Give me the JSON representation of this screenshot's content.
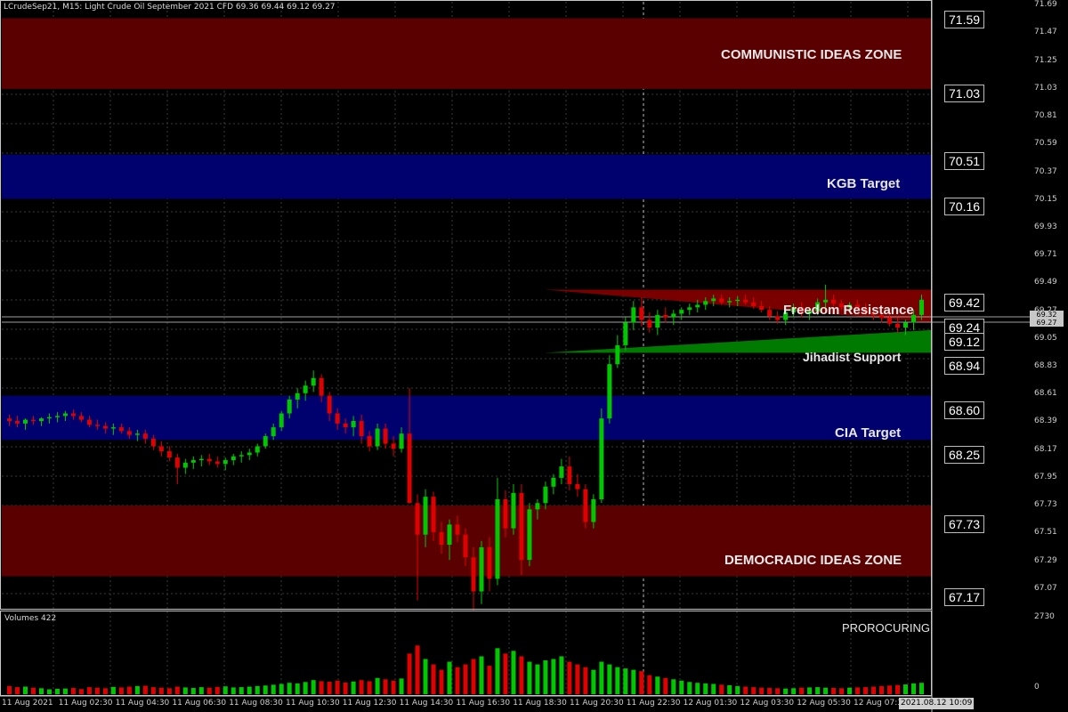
{
  "header": {
    "symbol_info": "LCrudeSep21, M15:  Light Crude Oil September 2021 CFD  69.36 69.44 69.12 69.27"
  },
  "zones": [
    {
      "name": "communistic",
      "label": "COMMUNISTIC IDEAS ZONE",
      "top": 71.59,
      "bottom": 71.03,
      "color": "#5a0000"
    },
    {
      "name": "kgb",
      "label": "KGB Target",
      "top": 70.51,
      "bottom": 70.16,
      "color": "#00006e"
    },
    {
      "name": "cia",
      "label": "CIA Target",
      "top": 68.6,
      "bottom": 68.25,
      "color": "#00006e"
    },
    {
      "name": "democradic",
      "label": "DEMOCRADIC IDEAS ZONE",
      "top": 67.73,
      "bottom": 67.17,
      "color": "#5a0000"
    }
  ],
  "wedges": {
    "resistance_label": "Freedom Resistance",
    "support_label": "Jihadist Support"
  },
  "level_tags": [
    "71.59",
    "71.03",
    "70.51",
    "70.16",
    "69.42",
    "69.24",
    "69.12",
    "68.94",
    "68.60",
    "68.25",
    "67.73",
    "67.17"
  ],
  "price_scale": [
    "71.69",
    "71.47",
    "71.25",
    "71.03",
    "70.81",
    "70.59",
    "70.37",
    "70.15",
    "69.93",
    "69.71",
    "69.49",
    "69.27",
    "69.05",
    "68.83",
    "68.61",
    "68.39",
    "68.17",
    "67.95",
    "67.73",
    "67.51",
    "67.29",
    "67.07"
  ],
  "current_price": {
    "top": "69.32",
    "bottom": "69.27"
  },
  "time_scale": [
    "11 Aug 2021",
    "11 Aug 02:30",
    "11 Aug 04:30",
    "11 Aug 06:30",
    "11 Aug 08:30",
    "11 Aug 10:30",
    "11 Aug 12:30",
    "11 Aug 14:30",
    "11 Aug 16:30",
    "11 Aug 18:30",
    "11 Aug 20:30",
    "11 Aug 22:30",
    "12 Aug 01:30",
    "12 Aug 03:30",
    "12 Aug 05:30",
    "12 Aug 07:30"
  ],
  "cursor_time": "2021.08.12 10:09",
  "volume": {
    "label": "Volumes 422",
    "max_label": "2730",
    "min_label": "0",
    "indicator": "PROROCURING"
  },
  "colors": {
    "bull": "#00c800",
    "bear": "#e00000",
    "grid": "#3a3a3a",
    "resist": "#7a0000",
    "support": "#007a00"
  },
  "chart_data": {
    "type": "candlestick",
    "ylim": [
      66.92,
      71.72
    ],
    "candles": [
      [
        68.42,
        68.45,
        68.36,
        68.4
      ],
      [
        68.4,
        68.44,
        68.35,
        68.38
      ],
      [
        68.38,
        68.42,
        68.33,
        68.41
      ],
      [
        68.41,
        68.44,
        68.37,
        68.4
      ],
      [
        68.4,
        68.43,
        68.36,
        68.42
      ],
      [
        68.42,
        68.46,
        68.38,
        68.43
      ],
      [
        68.43,
        68.47,
        68.39,
        68.44
      ],
      [
        68.44,
        68.48,
        68.4,
        68.46
      ],
      [
        68.46,
        68.49,
        68.41,
        68.44
      ],
      [
        68.44,
        68.47,
        68.39,
        68.41
      ],
      [
        68.41,
        68.44,
        68.35,
        68.37
      ],
      [
        68.37,
        68.41,
        68.33,
        68.36
      ],
      [
        68.36,
        68.39,
        68.3,
        68.34
      ],
      [
        68.34,
        68.38,
        68.29,
        68.35
      ],
      [
        68.35,
        68.38,
        68.3,
        68.32
      ],
      [
        68.32,
        68.35,
        68.26,
        68.29
      ],
      [
        68.29,
        68.33,
        68.24,
        68.3
      ],
      [
        68.3,
        68.33,
        68.22,
        68.26
      ],
      [
        68.26,
        68.29,
        68.17,
        68.2
      ],
      [
        68.2,
        68.24,
        68.12,
        68.16
      ],
      [
        68.16,
        68.2,
        68.08,
        68.11
      ],
      [
        68.11,
        68.14,
        67.9,
        68.03
      ],
      [
        68.03,
        68.1,
        67.98,
        68.07
      ],
      [
        68.07,
        68.12,
        68.02,
        68.09
      ],
      [
        68.09,
        68.13,
        68.04,
        68.1
      ],
      [
        68.1,
        68.14,
        68.05,
        68.08
      ],
      [
        68.08,
        68.12,
        68.03,
        68.06
      ],
      [
        68.06,
        68.11,
        68.01,
        68.09
      ],
      [
        68.09,
        68.14,
        68.05,
        68.12
      ],
      [
        68.12,
        68.16,
        68.07,
        68.13
      ],
      [
        68.13,
        68.18,
        68.09,
        68.15
      ],
      [
        68.15,
        68.22,
        68.12,
        68.2
      ],
      [
        68.2,
        68.3,
        68.18,
        68.28
      ],
      [
        68.28,
        68.38,
        68.25,
        68.35
      ],
      [
        68.35,
        68.48,
        68.32,
        68.46
      ],
      [
        68.46,
        68.6,
        68.42,
        68.57
      ],
      [
        68.57,
        68.66,
        68.5,
        68.62
      ],
      [
        68.62,
        68.72,
        68.56,
        68.68
      ],
      [
        68.68,
        68.8,
        68.63,
        68.74
      ],
      [
        68.74,
        68.77,
        68.55,
        68.6
      ],
      [
        68.6,
        68.63,
        68.4,
        68.46
      ],
      [
        68.46,
        68.5,
        68.33,
        68.38
      ],
      [
        68.38,
        68.42,
        68.3,
        68.35
      ],
      [
        68.35,
        68.44,
        68.28,
        68.4
      ],
      [
        68.4,
        68.45,
        68.22,
        68.28
      ],
      [
        68.28,
        68.32,
        68.16,
        68.2
      ],
      [
        68.2,
        68.38,
        68.17,
        68.34
      ],
      [
        68.34,
        68.38,
        68.18,
        68.22
      ],
      [
        68.22,
        68.28,
        68.12,
        68.18
      ],
      [
        68.18,
        68.35,
        68.15,
        68.3
      ],
      [
        68.3,
        68.66,
        68.2,
        67.75
      ],
      [
        67.75,
        67.82,
        66.98,
        67.5
      ],
      [
        67.5,
        67.86,
        67.4,
        67.8
      ],
      [
        67.8,
        67.84,
        67.45,
        67.52
      ],
      [
        67.52,
        67.6,
        67.35,
        67.42
      ],
      [
        67.42,
        67.62,
        67.3,
        67.58
      ],
      [
        67.58,
        67.65,
        67.44,
        67.5
      ],
      [
        67.5,
        67.55,
        67.25,
        67.32
      ],
      [
        67.32,
        67.4,
        66.9,
        67.05
      ],
      [
        67.05,
        67.45,
        66.95,
        67.4
      ],
      [
        67.4,
        67.48,
        67.05,
        67.15
      ],
      [
        67.15,
        67.95,
        67.1,
        67.78
      ],
      [
        67.78,
        67.85,
        67.48,
        67.55
      ],
      [
        67.55,
        67.9,
        67.5,
        67.83
      ],
      [
        67.83,
        67.9,
        67.18,
        67.3
      ],
      [
        67.3,
        67.75,
        67.25,
        67.7
      ],
      [
        67.7,
        67.78,
        67.62,
        67.75
      ],
      [
        67.75,
        67.92,
        67.7,
        67.88
      ],
      [
        67.88,
        67.98,
        67.82,
        67.95
      ],
      [
        67.95,
        68.1,
        67.9,
        68.04
      ],
      [
        68.04,
        68.12,
        67.85,
        67.9
      ],
      [
        67.9,
        67.98,
        67.8,
        67.86
      ],
      [
        67.86,
        67.9,
        67.55,
        67.6
      ],
      [
        67.6,
        67.82,
        67.55,
        67.78
      ],
      [
        67.78,
        68.5,
        67.75,
        68.42
      ],
      [
        68.42,
        68.92,
        68.38,
        68.85
      ],
      [
        68.85,
        69.08,
        68.82,
        69.0
      ],
      [
        69.0,
        69.22,
        68.96,
        69.18
      ],
      [
        69.18,
        69.35,
        69.12,
        69.3
      ],
      [
        69.3,
        69.38,
        69.15,
        69.2
      ],
      [
        69.2,
        69.26,
        69.1,
        69.14
      ],
      [
        69.14,
        69.28,
        69.08,
        69.24
      ],
      [
        69.24,
        69.3,
        69.18,
        69.22
      ],
      [
        69.22,
        69.28,
        69.16,
        69.25
      ],
      [
        69.25,
        69.3,
        69.2,
        69.28
      ],
      [
        69.28,
        69.33,
        69.24,
        69.3
      ],
      [
        69.3,
        69.36,
        69.26,
        69.32
      ],
      [
        69.32,
        69.38,
        69.28,
        69.35
      ],
      [
        69.35,
        69.4,
        69.31,
        69.37
      ],
      [
        69.37,
        69.4,
        69.32,
        69.34
      ],
      [
        69.34,
        69.38,
        69.3,
        69.35
      ],
      [
        69.35,
        69.39,
        69.31,
        69.36
      ],
      [
        69.36,
        69.4,
        69.32,
        69.34
      ],
      [
        69.34,
        69.38,
        69.29,
        69.31
      ],
      [
        69.31,
        69.35,
        69.26,
        69.28
      ],
      [
        69.28,
        69.31,
        69.2,
        69.23
      ],
      [
        69.23,
        69.27,
        69.17,
        69.2
      ],
      [
        69.2,
        69.28,
        69.16,
        69.26
      ],
      [
        69.26,
        69.33,
        69.22,
        69.3
      ],
      [
        69.3,
        69.34,
        69.22,
        69.25
      ],
      [
        69.25,
        69.3,
        69.2,
        69.27
      ],
      [
        69.27,
        69.37,
        69.24,
        69.34
      ],
      [
        69.34,
        69.48,
        69.3,
        69.36
      ],
      [
        69.36,
        69.4,
        69.31,
        69.33
      ],
      [
        69.33,
        69.36,
        69.28,
        69.3
      ],
      [
        69.3,
        69.34,
        69.26,
        69.32
      ],
      [
        69.32,
        69.36,
        69.27,
        69.29
      ],
      [
        69.29,
        69.33,
        69.24,
        69.26
      ],
      [
        69.26,
        69.3,
        69.2,
        69.24
      ],
      [
        69.24,
        69.28,
        69.18,
        69.22
      ],
      [
        69.22,
        69.27,
        69.15,
        69.17
      ],
      [
        69.17,
        69.22,
        69.1,
        69.14
      ],
      [
        69.14,
        69.2,
        69.08,
        69.18
      ],
      [
        69.18,
        69.28,
        69.12,
        69.24
      ],
      [
        69.24,
        69.4,
        69.2,
        69.36
      ]
    ],
    "volumes": [
      300,
      260,
      280,
      240,
      220,
      180,
      200,
      210,
      230,
      190,
      260,
      240,
      220,
      270,
      250,
      280,
      300,
      310,
      260,
      240,
      220,
      280,
      250,
      230,
      260,
      240,
      270,
      290,
      250,
      260,
      280,
      300,
      320,
      350,
      380,
      420,
      400,
      450,
      520,
      480,
      460,
      500,
      430,
      470,
      520,
      480,
      600,
      550,
      500,
      580,
      1500,
      1800,
      1300,
      1100,
      900,
      1200,
      1000,
      1100,
      1300,
      1400,
      1050,
      1700,
      1500,
      1600,
      1400,
      1200,
      1100,
      1250,
      1300,
      1400,
      1200,
      1100,
      1000,
      900,
      1200,
      1100,
      1000,
      950,
      900,
      850,
      700,
      650,
      600,
      550,
      500,
      450,
      420,
      400,
      380,
      350,
      330,
      300,
      280,
      260,
      240,
      230,
      220,
      210,
      220,
      240,
      250,
      260,
      240,
      230,
      220,
      240,
      250,
      260,
      280,
      300,
      320,
      340,
      360,
      400,
      420
    ]
  }
}
